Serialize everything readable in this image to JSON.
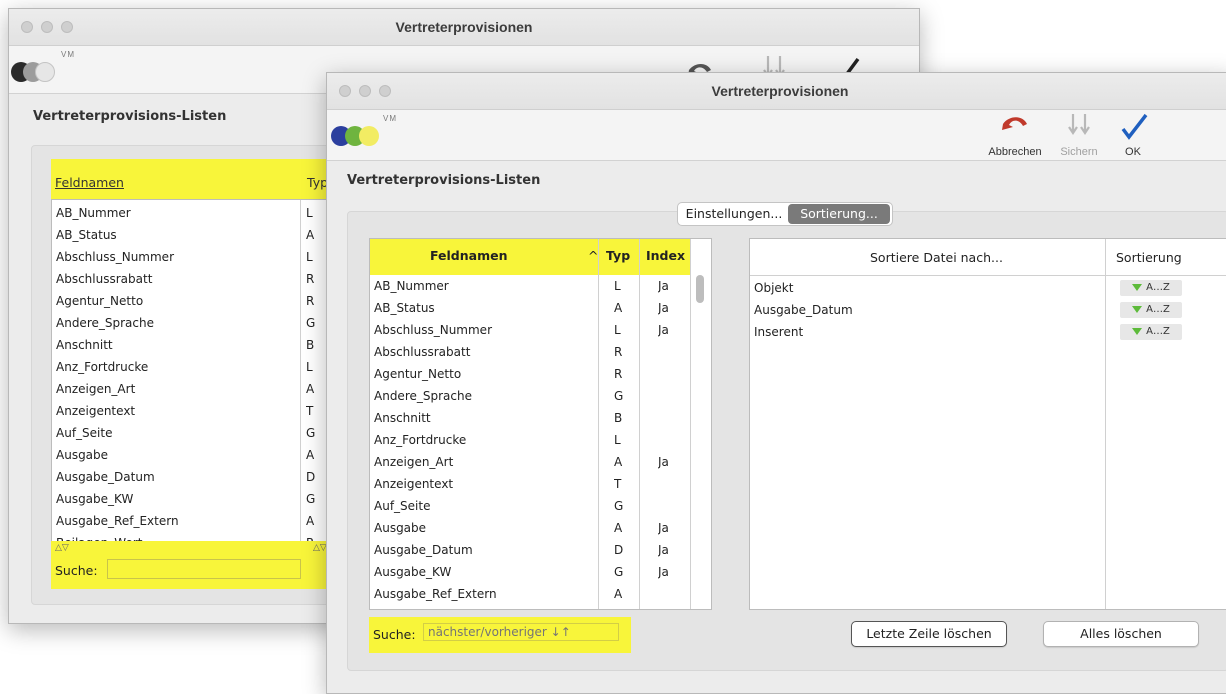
{
  "back_window": {
    "title": "Vertreterprovisionen",
    "logo_text": "VM",
    "section_title": "Vertreterprovisions-Listen",
    "header_feldnamen": "Feldnamen",
    "header_typ": "Typ",
    "rows": [
      {
        "name": "AB_Nummer",
        "typ": "L"
      },
      {
        "name": "AB_Status",
        "typ": "A"
      },
      {
        "name": "Abschluss_Nummer",
        "typ": "L"
      },
      {
        "name": "Abschlussrabatt",
        "typ": "R"
      },
      {
        "name": "Agentur_Netto",
        "typ": "R"
      },
      {
        "name": "Andere_Sprache",
        "typ": "G"
      },
      {
        "name": "Anschnitt",
        "typ": "B"
      },
      {
        "name": "Anz_Fortdrucke",
        "typ": "L"
      },
      {
        "name": "Anzeigen_Art",
        "typ": "A"
      },
      {
        "name": "Anzeigentext",
        "typ": "T"
      },
      {
        "name": "Auf_Seite",
        "typ": "G"
      },
      {
        "name": "Ausgabe",
        "typ": "A"
      },
      {
        "name": "Ausgabe_Datum",
        "typ": "D"
      },
      {
        "name": "Ausgabe_KW",
        "typ": "G"
      },
      {
        "name": "Ausgabe_Ref_Extern",
        "typ": "A"
      },
      {
        "name": "Beilagen_Wert",
        "typ": "R"
      }
    ],
    "search_label": "Suche:"
  },
  "front_window": {
    "title": "Vertreterprovisionen",
    "logo_text": "VM",
    "toolbar": {
      "cancel_label": "Abbrechen",
      "save_label": "Sichern",
      "ok_label": "OK"
    },
    "section_title": "Vertreterprovisions-Listen",
    "tabs": [
      {
        "label": "Einstellungen...",
        "selected": false
      },
      {
        "label": "Sortierung...",
        "selected": true
      }
    ],
    "fields_table": {
      "header_name": "Feldnamen",
      "sort_indicator": "^",
      "header_typ": "Typ",
      "header_index": "Index",
      "rows": [
        {
          "name": "AB_Nummer",
          "typ": "L",
          "index": "Ja"
        },
        {
          "name": "AB_Status",
          "typ": "A",
          "index": "Ja"
        },
        {
          "name": "Abschluss_Nummer",
          "typ": "L",
          "index": "Ja"
        },
        {
          "name": "Abschlussrabatt",
          "typ": "R",
          "index": ""
        },
        {
          "name": "Agentur_Netto",
          "typ": "R",
          "index": ""
        },
        {
          "name": "Andere_Sprache",
          "typ": "G",
          "index": ""
        },
        {
          "name": "Anschnitt",
          "typ": "B",
          "index": ""
        },
        {
          "name": "Anz_Fortdrucke",
          "typ": "L",
          "index": ""
        },
        {
          "name": "Anzeigen_Art",
          "typ": "A",
          "index": "Ja"
        },
        {
          "name": "Anzeigentext",
          "typ": "T",
          "index": ""
        },
        {
          "name": "Auf_Seite",
          "typ": "G",
          "index": ""
        },
        {
          "name": "Ausgabe",
          "typ": "A",
          "index": "Ja"
        },
        {
          "name": "Ausgabe_Datum",
          "typ": "D",
          "index": "Ja"
        },
        {
          "name": "Ausgabe_KW",
          "typ": "G",
          "index": "Ja"
        },
        {
          "name": "Ausgabe_Ref_Extern",
          "typ": "A",
          "index": ""
        }
      ]
    },
    "sort_table": {
      "header_name": "Sortiere Datei nach...",
      "header_sort": "Sortierung",
      "rows": [
        {
          "name": "Objekt",
          "sort": "A…Z"
        },
        {
          "name": "Ausgabe_Datum",
          "sort": "A…Z"
        },
        {
          "name": "Inserent",
          "sort": "A…Z"
        }
      ]
    },
    "search": {
      "label": "Suche:",
      "placeholder": "nächster/vorheriger ↓↑"
    },
    "buttons": {
      "delete_last_row": "Letzte Zeile löschen",
      "delete_all": "Alles löschen"
    }
  },
  "colors": {
    "highlight": "#f8f53a",
    "logo_blue": "#2b3f9e",
    "logo_green": "#6fb43f",
    "logo_yellow": "#f2ec63",
    "cancel_red": "#c0392b",
    "ok_blue": "#1f5fbf",
    "sort_green": "#5dbb3a"
  },
  "icons": [
    "undo-arrow-icon",
    "save-arrows-icon",
    "checkmark-icon",
    "triangle-down-icon",
    "sort-arrows-icon"
  ]
}
